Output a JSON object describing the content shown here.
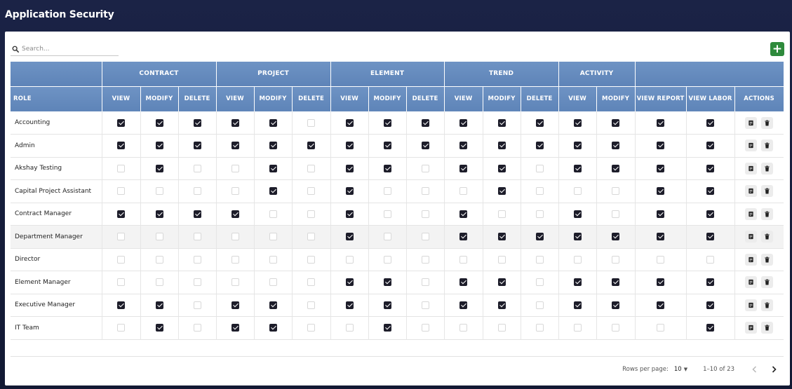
{
  "app": {
    "title": "Application Security"
  },
  "search": {
    "placeholder": "Search..."
  },
  "toolbar": {
    "add_label": "+"
  },
  "groups": [
    {
      "label": "",
      "span": 1
    },
    {
      "label": "CONTRACT",
      "span": 3
    },
    {
      "label": "PROJECT",
      "span": 3
    },
    {
      "label": "ELEMENT",
      "span": 3
    },
    {
      "label": "TREND",
      "span": 3
    },
    {
      "label": "ACTIVITY",
      "span": 2
    },
    {
      "label": "",
      "span": 3
    }
  ],
  "columns": [
    "ROLE",
    "VIEW",
    "MODIFY",
    "DELETE",
    "VIEW",
    "MODIFY",
    "DELETE",
    "VIEW",
    "MODIFY",
    "DELETE",
    "VIEW",
    "MODIFY",
    "DELETE",
    "VIEW",
    "MODIFY",
    "VIEW REPORT",
    "VIEW LABOR",
    "ACTIONS"
  ],
  "rows": [
    {
      "role": "Accounting",
      "perms": [
        1,
        1,
        1,
        1,
        1,
        0,
        1,
        1,
        1,
        1,
        1,
        1,
        1,
        1,
        1,
        1
      ]
    },
    {
      "role": "Admin",
      "perms": [
        1,
        1,
        1,
        1,
        1,
        1,
        1,
        1,
        1,
        1,
        1,
        1,
        1,
        1,
        1,
        1
      ]
    },
    {
      "role": "Akshay Testing",
      "perms": [
        0,
        1,
        0,
        0,
        1,
        0,
        1,
        1,
        0,
        1,
        1,
        0,
        1,
        1,
        1,
        1
      ]
    },
    {
      "role": "Capital Project Assistant",
      "perms": [
        0,
        0,
        0,
        0,
        1,
        0,
        1,
        0,
        0,
        0,
        1,
        0,
        0,
        0,
        1,
        1
      ]
    },
    {
      "role": "Contract Manager",
      "perms": [
        1,
        1,
        1,
        1,
        0,
        0,
        1,
        0,
        0,
        1,
        0,
        0,
        1,
        0,
        1,
        1
      ]
    },
    {
      "role": "Department Manager",
      "perms": [
        0,
        0,
        0,
        0,
        0,
        0,
        1,
        0,
        0,
        1,
        1,
        1,
        1,
        1,
        1,
        1
      ],
      "shaded": true
    },
    {
      "role": "Director",
      "perms": [
        0,
        0,
        0,
        0,
        0,
        0,
        0,
        0,
        0,
        0,
        0,
        0,
        0,
        0,
        0,
        0
      ]
    },
    {
      "role": "Element Manager",
      "perms": [
        0,
        0,
        0,
        0,
        0,
        0,
        1,
        1,
        0,
        1,
        1,
        0,
        1,
        1,
        1,
        1
      ]
    },
    {
      "role": "Executive Manager",
      "perms": [
        1,
        1,
        0,
        1,
        1,
        0,
        1,
        1,
        0,
        1,
        1,
        0,
        1,
        1,
        1,
        1
      ]
    },
    {
      "role": "IT Team",
      "perms": [
        0,
        1,
        0,
        1,
        1,
        0,
        0,
        1,
        0,
        0,
        0,
        0,
        0,
        0,
        0,
        1
      ]
    }
  ],
  "footer": {
    "rows_per_page_label": "Rows per page:",
    "rows_per_page_value": "10",
    "range": "1–10 of 23"
  },
  "colors": {
    "header": "#6e93c4",
    "add_button": "#2e8a3c",
    "checkbox_on": "#1d1d2a"
  }
}
